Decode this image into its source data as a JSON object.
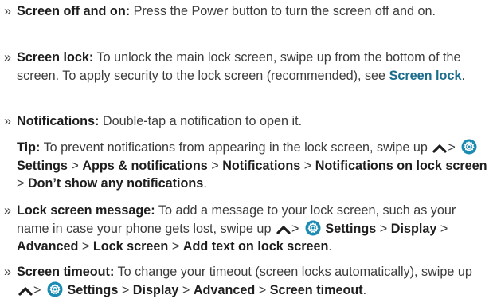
{
  "bullet": "»",
  "items": [
    {
      "label": "Screen off and on:",
      "t1": " Press the Power button to turn the screen off and on."
    },
    {
      "label": "Screen lock:",
      "t1": " To unlock the main lock screen, swipe up from the bottom of the screen. To apply security to the lock screen (recommended), see ",
      "link": "Screen lock",
      "t2": "."
    },
    {
      "label": "Notifications:",
      "t1": " Double-tap a notification to open it."
    },
    {
      "label": "Lock screen message:",
      "t1": " To add a message to your lock screen, such as your name in case your phone gets lost, swipe up",
      "gt": ">",
      "settings": "Settings",
      "path": [
        "Display",
        "Advanced",
        "Lock screen",
        "Add text on lock screen"
      ],
      "end": "."
    },
    {
      "label": "Screen timeout:",
      "t1": " To change your timeout (screen locks automatically), swipe up",
      "gt": ">",
      "settings": "Settings",
      "path": [
        "Display",
        "Advanced",
        "Screen timeout"
      ],
      "end": "."
    }
  ],
  "tip": {
    "label": "Tip:",
    "t1": " To prevent notifications from appearing in the lock screen, swipe up",
    "gt": ">",
    "settings": "Settings",
    "path": [
      "Apps & notifications",
      "Notifications",
      "Notifications on lock screen",
      "Don’t show any notifications"
    ],
    "end": "."
  },
  "colors": {
    "text": "#3c3c3c",
    "bold": "#1e1e1e",
    "link": "#1b6d8c",
    "icon": "#1a8bb3"
  },
  "icons": [
    "bullet-marker",
    "caret-up-icon",
    "settings-gear-icon"
  ]
}
